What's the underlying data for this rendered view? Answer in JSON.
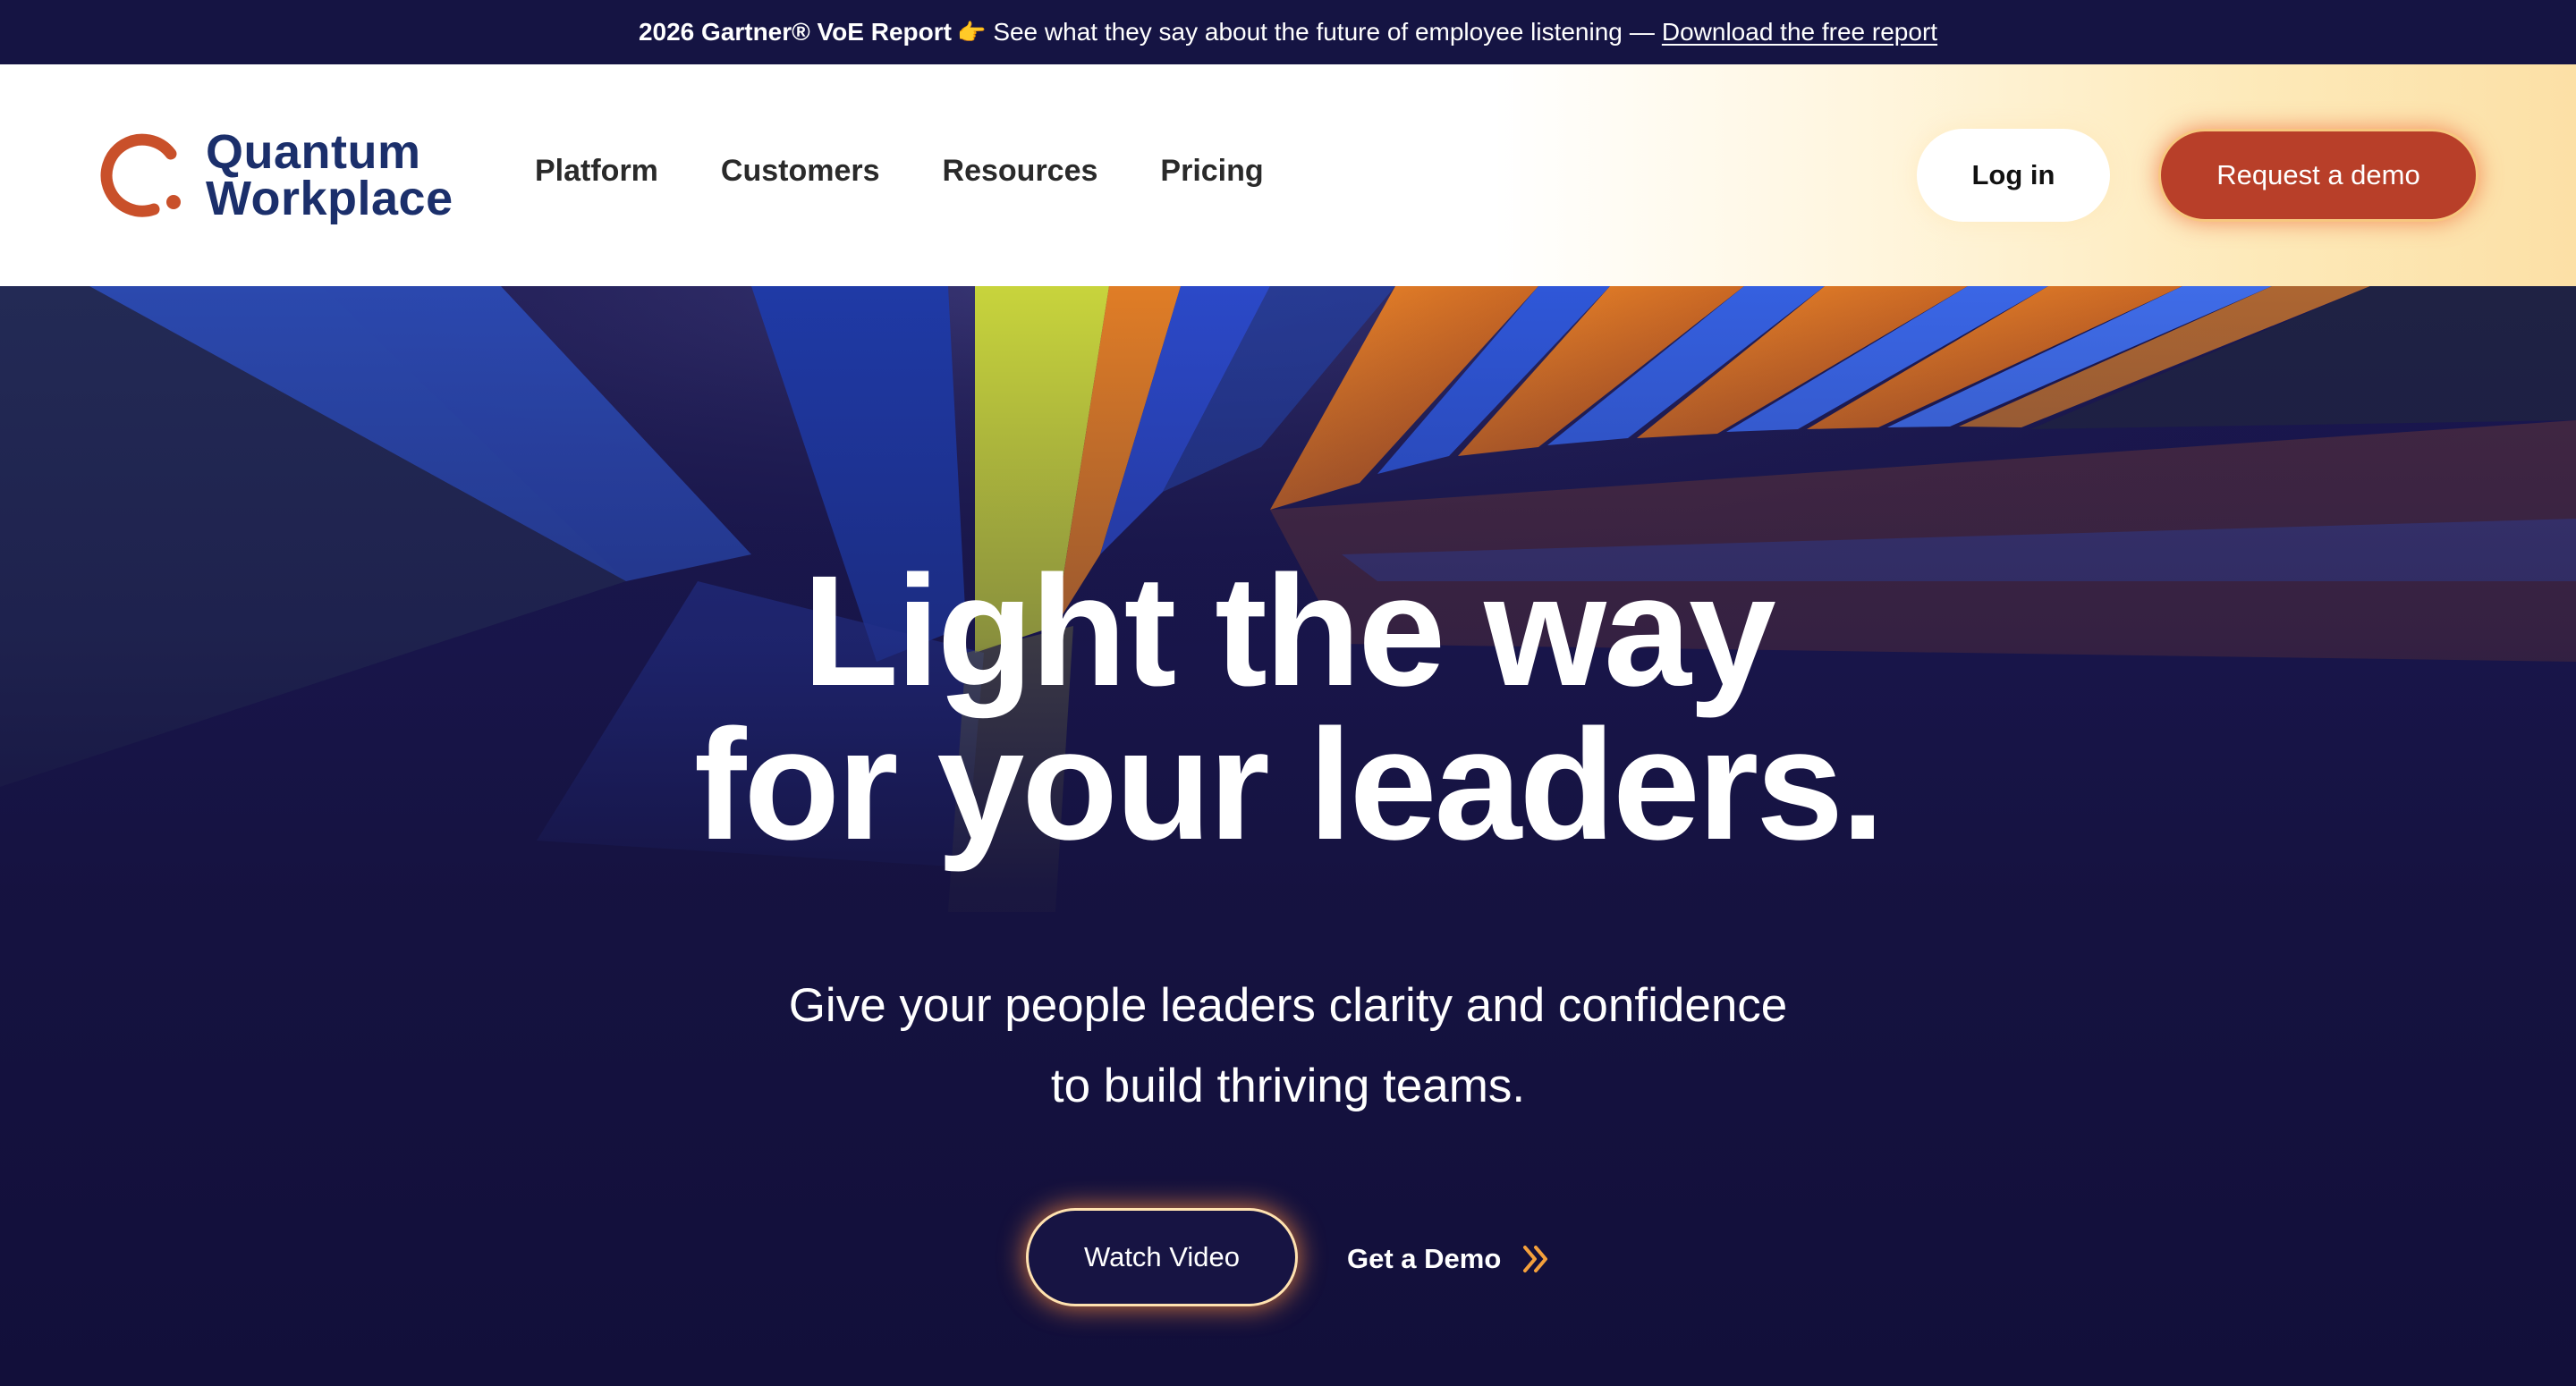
{
  "announcement": {
    "bold": "2026 Gartner® VoE Report",
    "pointer_icon": "👉",
    "text": "See what they say about the future of employee listening",
    "separator": "—",
    "link": "Download the free report"
  },
  "brand": {
    "name_line1": "Quantum",
    "name_line2": "Workplace",
    "color_logo_mark": "#c9502a",
    "color_logo_text": "#1b2f6b"
  },
  "nav": {
    "items": [
      {
        "label": "Platform"
      },
      {
        "label": "Customers"
      },
      {
        "label": "Resources"
      },
      {
        "label": "Pricing"
      }
    ]
  },
  "header_actions": {
    "login_label": "Log in",
    "demo_label": "Request a demo",
    "demo_color": "#b83f29"
  },
  "hero": {
    "headline_line1": "Light the way",
    "headline_line2": "for your leaders.",
    "sub_line1": "Give your people leaders clarity and confidence",
    "sub_line2": "to build thriving teams.",
    "watch_label": "Watch Video",
    "get_demo_label": "Get a Demo",
    "get_demo_icon": "double-chevron-right-icon"
  }
}
